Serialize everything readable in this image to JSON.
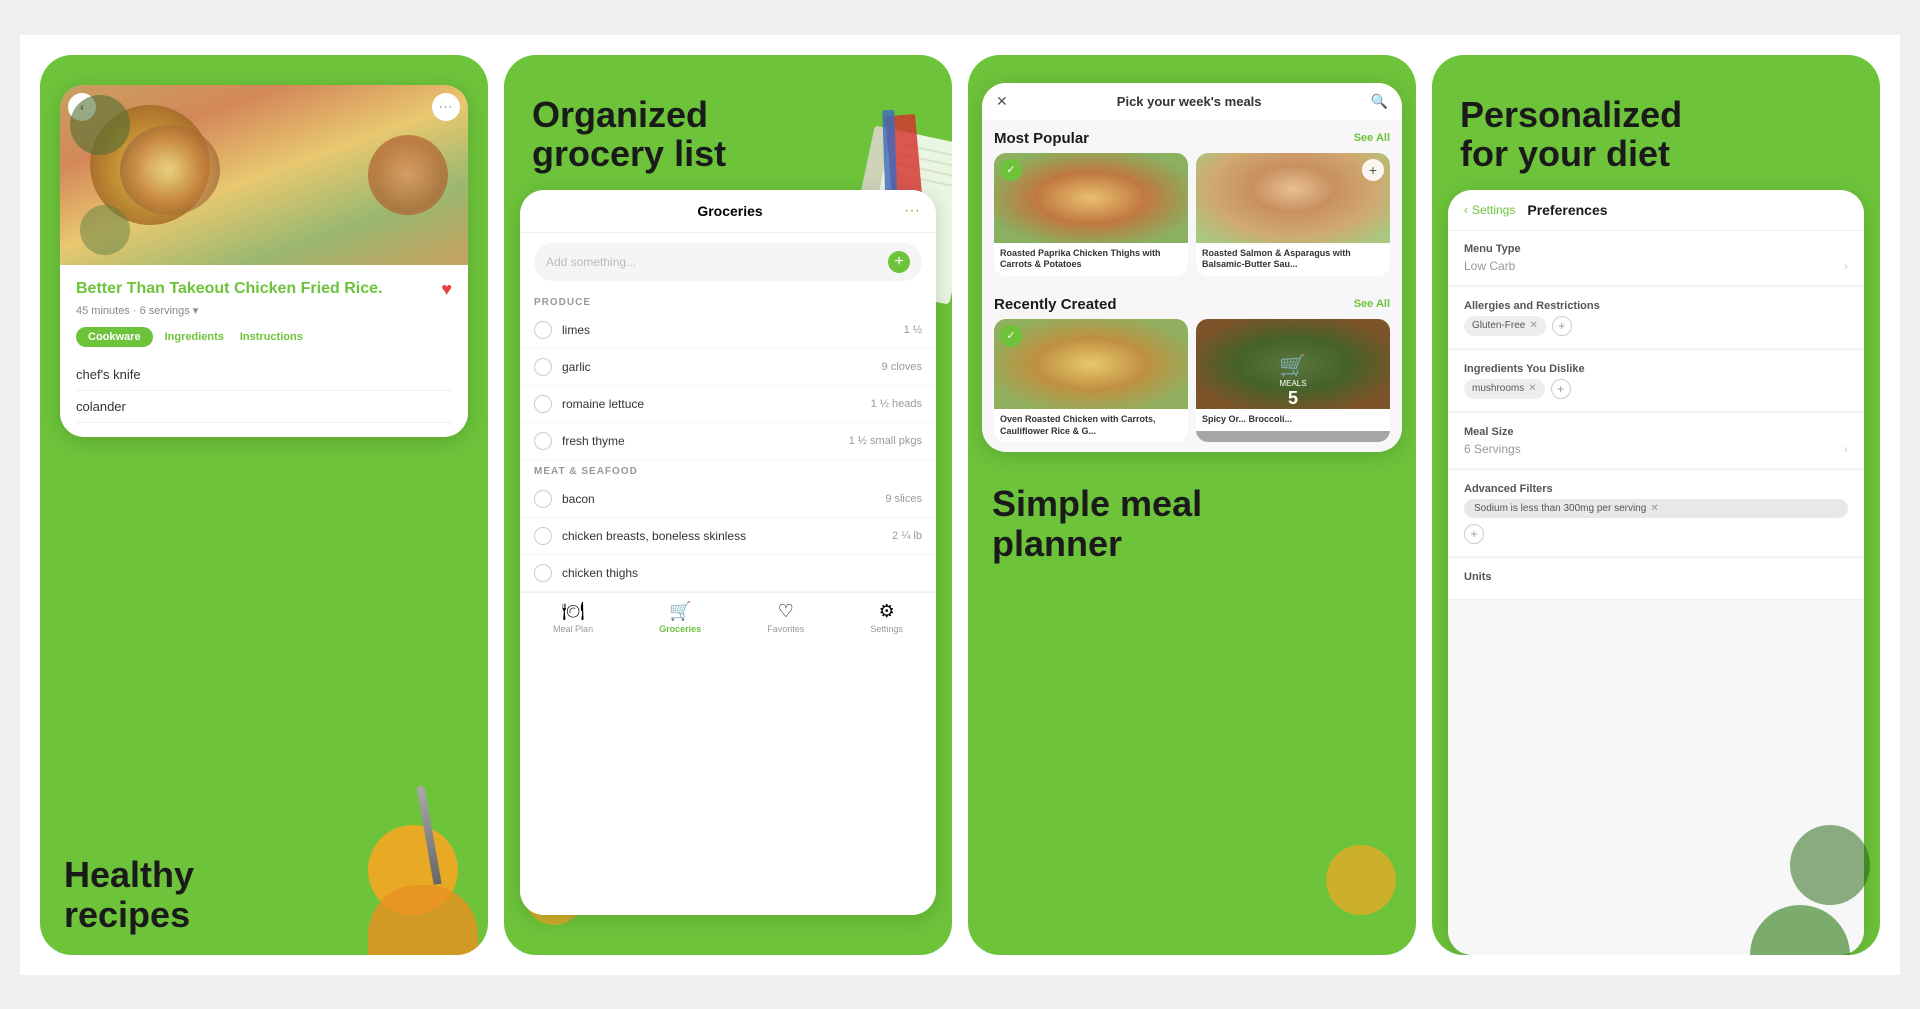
{
  "panel1": {
    "heading_line1": "Healthy",
    "heading_line2": "recipes",
    "recipe": {
      "title": "Better Than Takeout Chicken Fried Rice",
      "title_period": ".",
      "meta": "45 minutes · 6 servings ▾",
      "tabs": [
        "Cookware",
        "Ingredients",
        "Instructions"
      ],
      "active_tab": "Cookware",
      "items": [
        "chef's knife",
        "colander"
      ]
    },
    "back_label": "‹",
    "more_label": "···"
  },
  "panel2": {
    "heading_line1": "Organized",
    "heading_line2": "grocery list",
    "grocery": {
      "title": "Groceries",
      "add_placeholder": "Add something...",
      "dots": "···",
      "sections": [
        {
          "name": "PRODUCE",
          "items": [
            {
              "name": "limes",
              "qty": "1 ½"
            },
            {
              "name": "garlic",
              "qty": "9 cloves"
            },
            {
              "name": "romaine lettuce",
              "qty": "1 ½ heads"
            },
            {
              "name": "fresh thyme",
              "qty": "1 ½ small pkgs"
            }
          ]
        },
        {
          "name": "MEAT & SEAFOOD",
          "items": [
            {
              "name": "bacon",
              "qty": "9 slices"
            },
            {
              "name": "chicken breasts, boneless skinless",
              "qty": "2 ¼ lb"
            },
            {
              "name": "chicken thighs",
              "qty": ""
            }
          ]
        }
      ],
      "nav": [
        {
          "icon": "🍽",
          "label": "Meal Plan",
          "active": false
        },
        {
          "icon": "🛒",
          "label": "Groceries",
          "active": true
        },
        {
          "icon": "♡",
          "label": "Favorites",
          "active": false
        },
        {
          "icon": "⚙",
          "label": "Settings",
          "active": false
        }
      ]
    }
  },
  "panel3": {
    "heading_line1": "Simple meal",
    "heading_line2": "planner",
    "meal_planner": {
      "header_title": "Pick your week's meals",
      "close_icon": "✕",
      "search_icon": "🔍",
      "sections": [
        {
          "title": "Most Popular",
          "see_all": "See All",
          "items": [
            {
              "name": "Roasted Paprika Chicken Thighs with Carrots & Potatoes",
              "checked": true
            },
            {
              "name": "Roasted Salmon & Asparagus with Balsamic-Butter Sau...",
              "plus": true
            }
          ]
        },
        {
          "title": "Recently Created",
          "see_all": "See All",
          "items": [
            {
              "name": "Oven Roasted Chicken with Carrots, Cauliflower Rice & G...",
              "checked": true
            },
            {
              "name": "Spicy Or... Broccolí...",
              "cart": true,
              "meals_count": "5"
            }
          ]
        }
      ]
    }
  },
  "panel4": {
    "heading_line1": "Personalized",
    "heading_line2": "for your diet",
    "settings": {
      "back_label": "‹ Settings",
      "page_title": "Preferences",
      "sections": [
        {
          "title": "Menu Type",
          "value": "Low Carb",
          "has_chevron": true
        },
        {
          "title": "Allergies and Restrictions",
          "tags": [
            "Gluten-Free ✕"
          ],
          "has_plus": true
        },
        {
          "title": "Ingredients You Dislike",
          "tags": [
            "mushrooms ✕"
          ],
          "has_plus": true
        },
        {
          "title": "Meal Size",
          "value": "6 Servings",
          "has_chevron": true
        },
        {
          "title": "Advanced Filters",
          "filter_tag": "Sodium is less than 300mg per serving ✕",
          "has_plus": true
        },
        {
          "title": "Units",
          "value": "",
          "has_chevron": false
        }
      ]
    }
  }
}
